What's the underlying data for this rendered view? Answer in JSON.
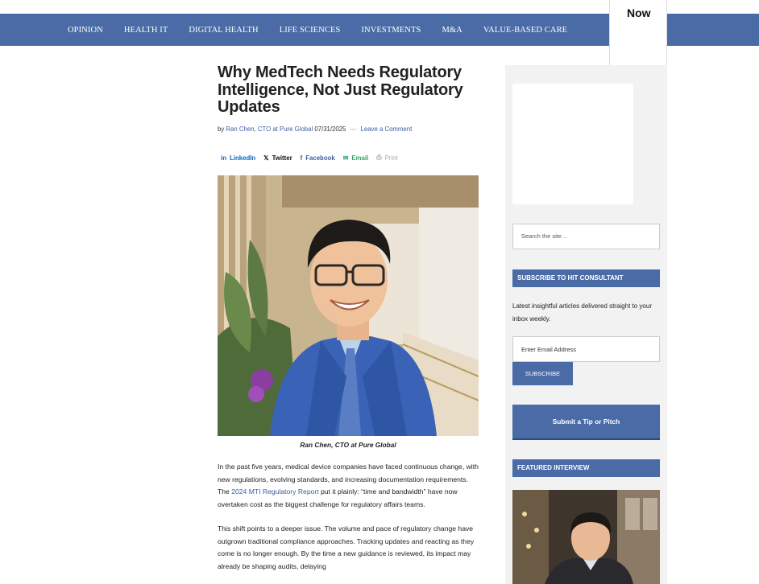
{
  "nav": {
    "items": [
      "OPINION",
      "HEALTH IT",
      "DIGITAL HEALTH",
      "LIFE SCIENCES",
      "INVESTMENTS",
      "M&A",
      "VALUE-BASED CARE"
    ],
    "now_label": "Now"
  },
  "article": {
    "title": "Why MedTech Needs Regulatory Intelligence, Not Just Regulatory Updates",
    "byline_prefix": "by",
    "author": "Ran Chen, CTO at Pure Global",
    "date": "07/31/2025",
    "comment_link": "Leave a Comment",
    "share": [
      {
        "label": "LinkedIn",
        "icon": "in",
        "color": "#0a66c2"
      },
      {
        "label": "Twitter",
        "icon": "𝕏",
        "color": "#111111"
      },
      {
        "label": "Facebook",
        "icon": "f",
        "color": "#3b5ea3"
      },
      {
        "label": "Email",
        "icon": "✉",
        "color": "#38a169"
      },
      {
        "label": "Print",
        "icon": "⎙",
        "color": "#aaaaaa"
      }
    ],
    "caption": "Ran Chen, CTO at Pure Global",
    "p1_before": "In the past five years, medical device companies have faced continuous change, with new regulations, evolving standards, and increasing documentation requirements. The ",
    "p1_link": "2024 MTI Regulatory Report",
    "p1_after": " put it plainly: “time and bandwidth” have now overtaken cost as the biggest challenge for regulatory affairs teams.",
    "p2": "This shift points to a deeper issue. The volume and pace of regulatory change have outgrown traditional compliance approaches. Tracking updates and reacting as they come is no longer enough. By the time a new guidance is reviewed, its impact may already be shaping audits, delaying"
  },
  "sidebar": {
    "search_placeholder": "Search the site ..",
    "subscribe_heading": "SUBSCRIBE TO HIT CONSULTANT",
    "subscribe_text": "Latest insightful articles delivered straight to your inbox weekly.",
    "email_placeholder": "Enter Email Address",
    "subscribe_button": "SUBSCRIBE",
    "tip_button": "Submit a Tip or Pitch",
    "featured_heading": "FEATURED INTERVIEW"
  },
  "colors": {
    "brand_blue": "#4a6ba6",
    "link_blue": "#3b5ea3"
  }
}
